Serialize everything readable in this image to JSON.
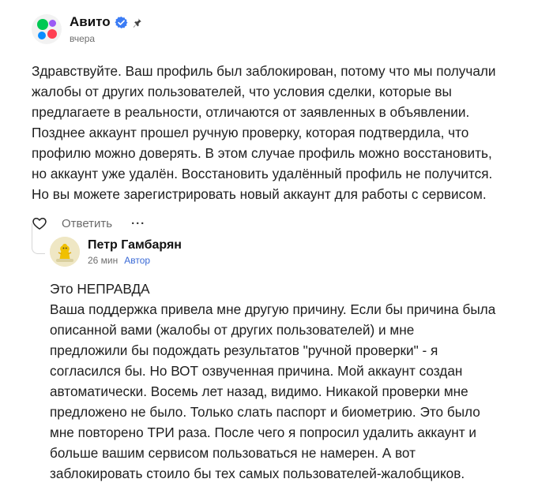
{
  "comment": {
    "author": "Авито",
    "time": "вчера",
    "avatar_icon": "avito-logo",
    "verified_icon": "verified-badge-icon",
    "pin_icon": "pin-icon",
    "text": "Здравствуйте. Ваш профиль был заблокирован, потому что мы получали\nжалобы от других пользователей, что условия сделки, которые вы\nпредлагаете в реальности, отличаются от заявленных в объявлении.\nПозднее аккаунт прошел ручную проверку, которая подтвердила, что\nпрофилю можно доверять. В этом случае профиль можно восстановить,\nно аккаунт уже удалён. Восстановить удалённый профиль не получится.\nНо вы можете зарегистрировать новый аккаунт для работы с сервисом.",
    "actions": {
      "like_icon": "heart-icon",
      "reply_label": "Ответить",
      "more_label": "···"
    }
  },
  "reply": {
    "author": "Петр Гамбарян",
    "time": "26 мин",
    "badge": "Автор",
    "text": "Это НЕПРАВДА\nВаша поддержка привела мне другую причину. Если бы причина была\nописанной вами (жалобы от других пользователей) и мне\nпредложили бы подождать результатов \"ручной проверки\" - я\nсогласился бы. Но ВОТ озвученная причина. Мой аккаунт создан\nавтоматически. Восемь лет назад, видимо. Никакой проверки мне\nпредложено не было. Только слать паспорт и биометрию. Это было\nмне повторено ТРИ раза. После чего я попросил удалить аккаунт и\nбольше вашим сервисом пользоваться не намерен. А вот\nзаблокировать стоило бы тех самых пользователей-жалобщиков."
  },
  "colors": {
    "verified": "#3b7cf5",
    "avito_green": "#00c853",
    "avito_blue": "#0a8cff",
    "avito_red": "#ff4053",
    "avito_purple": "#9b59f5",
    "author_badge": "#3a6ad6"
  }
}
